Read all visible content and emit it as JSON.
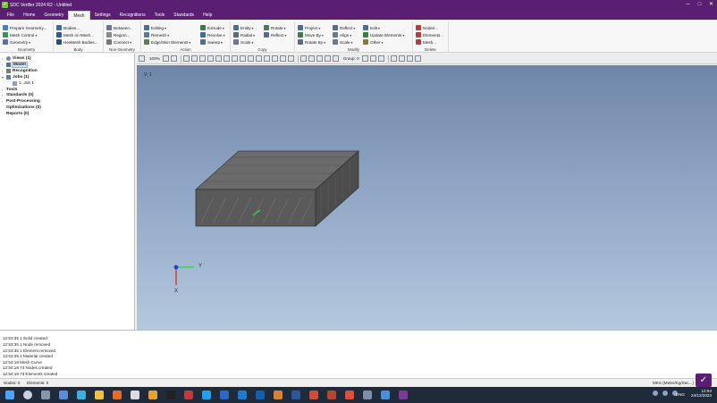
{
  "window": {
    "title": "SDC Verifier 2024 R2 - Untitled"
  },
  "menu": {
    "tabs": [
      "File",
      "Home",
      "Geometry",
      "Mesh",
      "Settings",
      "Recognitions",
      "Tools",
      "Standards",
      "Help"
    ],
    "active": "Mesh"
  },
  "ribbon": {
    "groups": [
      {
        "label": "Geometry",
        "items": [
          "Prepare Geometry...",
          "Mesh Control",
          "Geometry"
        ]
      },
      {
        "label": "Body",
        "items": [
          "Bodies...",
          "Mesh on Mesh...",
          "HexMesh Bodies..."
        ]
      },
      {
        "label": "Non-Geometry",
        "items": [
          "Between...",
          "Region...",
          "Connect"
        ]
      },
      {
        "label": "Action",
        "items": [
          "Editing",
          "Remesh",
          "Edge/Skin Elements",
          "Extrude",
          "Revolve",
          "Sweep"
        ]
      },
      {
        "label": "Copy",
        "items": [
          "Entity",
          "Radial",
          "Scale",
          "Rotate",
          "Reflect"
        ]
      },
      {
        "label": "Modify",
        "items": [
          "Project",
          "Move By",
          "Rotate By",
          "Reflect",
          "Align",
          "Scale",
          "Edit",
          "Update Elements",
          "Other"
        ]
      },
      {
        "label": "Delete",
        "items": [
          "Nodes...",
          "Elements...",
          "Mesh..."
        ]
      }
    ]
  },
  "tree": {
    "nodes": [
      {
        "label": "Views (1)",
        "icon": "eye-icon"
      },
      {
        "label": "Model",
        "icon": "model-icon",
        "selected": true
      },
      {
        "label": "Recognition",
        "icon": "recognition-icon"
      },
      {
        "label": "Jobs (1)",
        "icon": "jobs-icon"
      },
      {
        "label": "1. Job 1",
        "icon": "job-icon"
      },
      {
        "label": "Tools",
        "icon": "tools-icon"
      },
      {
        "label": "Standards (0)",
        "icon": "standards-icon"
      },
      {
        "label": "Post-Processing",
        "icon": "postprocessing-icon"
      },
      {
        "label": "Optimizations (0)",
        "icon": "optimization-icon"
      },
      {
        "label": "Reports (0)",
        "icon": "reports-icon"
      }
    ]
  },
  "toolbar": {
    "zoom": "100%",
    "group": "Group: 0"
  },
  "viewport": {
    "view_label": "V: 1",
    "axis_y": "Y",
    "axis_x": "X"
  },
  "log": {
    "lines": [
      "12:53:35 1 Solid created",
      "12:53:35 1 Node removed",
      "12:53:35 1 Element removed",
      "12:53:35 1 Material created",
      "12:54:18 Mesh Curve",
      "12:54:18 74 Nodes created",
      "12:54:18 73 Elements created"
    ]
  },
  "status": {
    "nodes": "Nodes: 0",
    "elements": "Elements: 0",
    "units": "MKS (Meter/Kg/Sec...)"
  },
  "taskbar": {
    "lang": "ENG",
    "time": "12:54",
    "date": "24/12/2024"
  }
}
